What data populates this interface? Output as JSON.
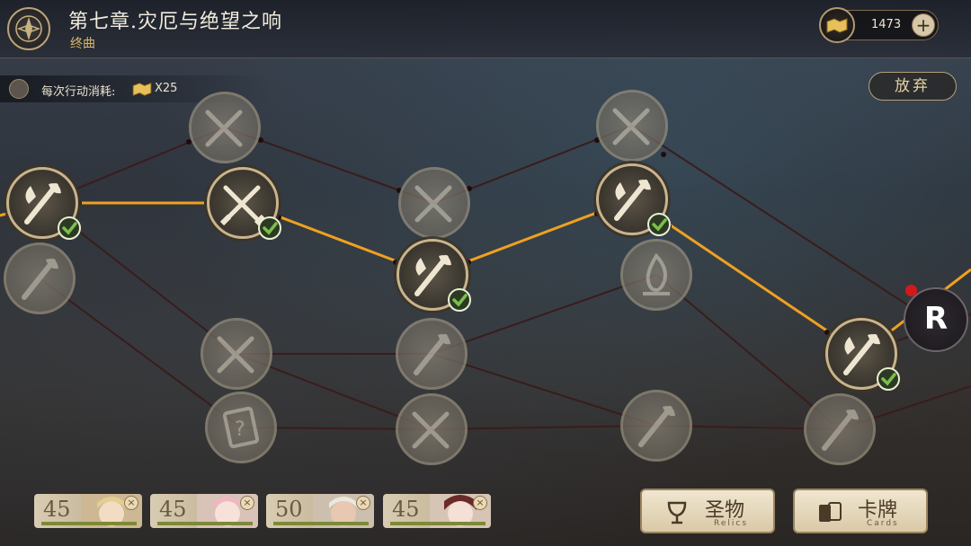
{
  "header": {
    "chapter_title": "第七章.灾厄与绝望之响",
    "chapter_subtitle": "终曲",
    "currency_value": "1473",
    "currency_add": "+"
  },
  "action_cost": {
    "label": "每次行动消耗:",
    "value": "X25"
  },
  "give_up_label": "放弃",
  "relic_node_label": "R",
  "party": [
    {
      "level": "45",
      "close": "×"
    },
    {
      "level": "45",
      "close": "×"
    },
    {
      "level": "50",
      "close": "×"
    },
    {
      "level": "45",
      "close": "×"
    }
  ],
  "buttons": {
    "relics_label": "圣物",
    "relics_sub": "Relics",
    "cards_label": "卡牌",
    "cards_sub": "Cards"
  },
  "colors": {
    "path_active": "#f0a020",
    "path_inactive": "#3a1c1c",
    "node_border": "#c9b48d",
    "check_green": "#7cc04a"
  },
  "map_nodes": [
    {
      "id": "n1",
      "icon": "axe-crossed-icon",
      "state": "completed"
    },
    {
      "id": "n2",
      "icon": "axe-crossed-icon",
      "state": "locked"
    },
    {
      "id": "n3",
      "icon": "swords-icon",
      "state": "locked"
    },
    {
      "id": "n4",
      "icon": "swords-icon",
      "state": "completed"
    },
    {
      "id": "n5",
      "icon": "swords-icon",
      "state": "locked"
    },
    {
      "id": "n6",
      "icon": "mystery-card-icon",
      "state": "locked"
    },
    {
      "id": "n7",
      "icon": "swords-icon",
      "state": "locked"
    },
    {
      "id": "n8",
      "icon": "axe-crossed-icon",
      "state": "completed"
    },
    {
      "id": "n9",
      "icon": "axe-crossed-icon",
      "state": "locked"
    },
    {
      "id": "n10",
      "icon": "swords-icon",
      "state": "locked"
    },
    {
      "id": "n11",
      "icon": "swords-icon",
      "state": "locked"
    },
    {
      "id": "n12",
      "icon": "axe-crossed-icon",
      "state": "completed"
    },
    {
      "id": "n13",
      "icon": "campfire-icon",
      "state": "locked"
    },
    {
      "id": "n14",
      "icon": "axe-crossed-icon",
      "state": "locked"
    },
    {
      "id": "n15",
      "icon": "axe-crossed-icon",
      "state": "completed"
    },
    {
      "id": "n16",
      "icon": "axe-crossed-icon",
      "state": "locked"
    }
  ]
}
